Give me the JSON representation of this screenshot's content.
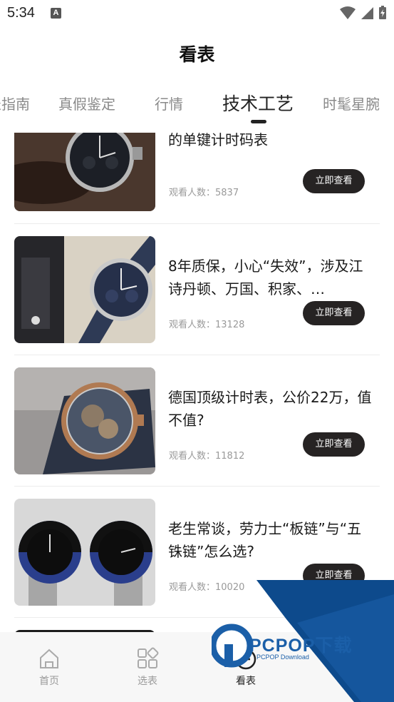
{
  "status": {
    "time": "5:34",
    "notification_icon": "a-icon"
  },
  "header": {
    "title": "看表"
  },
  "tabs": [
    {
      "label": "选表指南"
    },
    {
      "label": "真假鉴定"
    },
    {
      "label": "行情"
    },
    {
      "label": "技术工艺",
      "active": true
    },
    {
      "label": "时髦星腕"
    }
  ],
  "items": [
    {
      "title": "浪今经典复刻，一枚该价位罕见的单键计时码表",
      "views": "观看人数：5837",
      "button": "立即查看"
    },
    {
      "title": "8年质保，小心“失效”，涉及江诗丹顿、万国、积家、…",
      "views": "观看人数：13128",
      "button": "立即查看"
    },
    {
      "title": "德国顶级计时表，公价22万，值不值?",
      "views": "观看人数：11812",
      "button": "立即查看"
    },
    {
      "title": "老生常谈，劳力士“板链”与“五铢链”怎么选?",
      "views": "观看人数：10020",
      "button": "立即查看"
    }
  ],
  "nav": [
    {
      "label": "首页",
      "icon": "home-icon"
    },
    {
      "label": "选表",
      "icon": "grid-icon"
    },
    {
      "label": "看表",
      "icon": "watch-icon",
      "active": true
    }
  ],
  "watermark": {
    "brand": "PCPOP下载",
    "sub": "PCPOP Download"
  },
  "colors": {
    "accent": "#262323",
    "watermark": "#1b5fa8"
  }
}
